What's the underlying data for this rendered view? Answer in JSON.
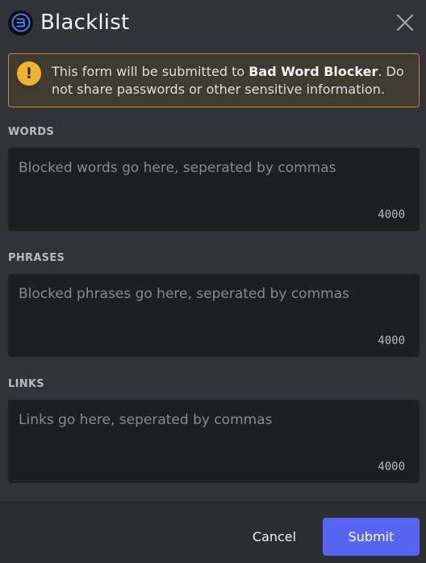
{
  "modal": {
    "title": "Blacklist",
    "app_icon": "app-logo-icon",
    "close_icon": "close-icon"
  },
  "warning": {
    "icon": "warning-icon",
    "glyph": "!",
    "prefix": "This form will be submitted to ",
    "app_name": "Bad Word Blocker",
    "suffix": ". Do not share passwords or other sensitive information."
  },
  "fields": [
    {
      "label": "WORDS",
      "placeholder": "Blocked words go here, seperated by commas",
      "value": "",
      "remaining": "4000"
    },
    {
      "label": "PHRASES",
      "placeholder": "Blocked phrases go here, seperated by commas",
      "value": "",
      "remaining": "4000"
    },
    {
      "label": "LINKS",
      "placeholder": "Links go here, seperated by commas",
      "value": "",
      "remaining": "4000"
    }
  ],
  "footer": {
    "cancel_label": "Cancel",
    "submit_label": "Submit"
  },
  "colors": {
    "accent": "#5865f2",
    "warning": "#f0b232",
    "background": "#313338",
    "input_background": "#1e1f22"
  }
}
